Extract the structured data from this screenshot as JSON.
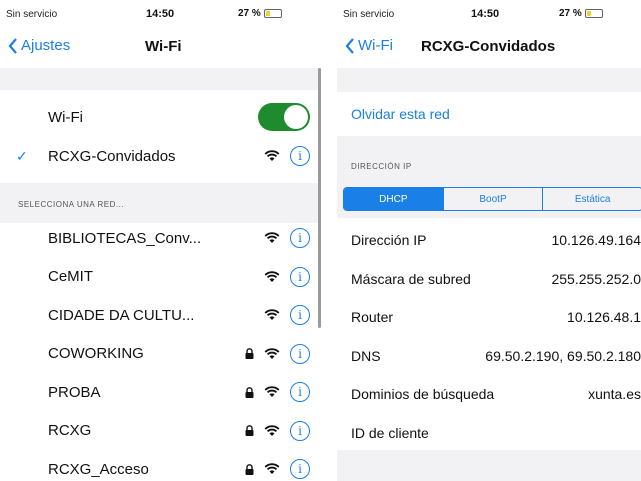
{
  "left": {
    "status": {
      "carrier": "Sin servicio",
      "time": "14:50",
      "battery": "27 %"
    },
    "nav": {
      "back_label": "Ajustes",
      "title": "Wi-Fi"
    },
    "wifi_label": "Wi-Fi",
    "wifi_enabled": true,
    "connected_network": "RCXG-Convidados",
    "section_header": "SELECCIONA UNA RED...",
    "networks": [
      {
        "name": "BIBLIOTECAS_Conv...",
        "locked": false
      },
      {
        "name": "CeMIT",
        "locked": false
      },
      {
        "name": "CIDADE DA CULTU...",
        "locked": false
      },
      {
        "name": "COWORKING",
        "locked": true
      },
      {
        "name": "PROBA",
        "locked": true
      },
      {
        "name": "RCXG",
        "locked": true
      },
      {
        "name": "RCXG_Acceso",
        "locked": true
      }
    ]
  },
  "right": {
    "status": {
      "carrier": "Sin servicio",
      "time": "14:50",
      "battery": "27 %"
    },
    "nav": {
      "back_label": "Wi-Fi",
      "title": "RCXG-Convidados"
    },
    "forget_label": "Olvidar esta red",
    "section_header": "DIRECCIÓN IP",
    "segments": [
      "DHCP",
      "BootP",
      "Estática"
    ],
    "rows": [
      {
        "key": "Dirección IP",
        "value": "10.126.49.164"
      },
      {
        "key": "Máscara de subred",
        "value": "255.255.252.0"
      },
      {
        "key": "Router",
        "value": "10.126.48.1"
      },
      {
        "key": "DNS",
        "value": "69.50.2.190, 69.50.2.180"
      },
      {
        "key": "Dominios de búsqueda",
        "value": "xunta.es"
      },
      {
        "key": "ID de cliente",
        "value": ""
      }
    ]
  },
  "colors": {
    "accent": "#1a7fe6",
    "toggle_on": "#1e8c2e",
    "group_bg": "#f2f2f4"
  }
}
